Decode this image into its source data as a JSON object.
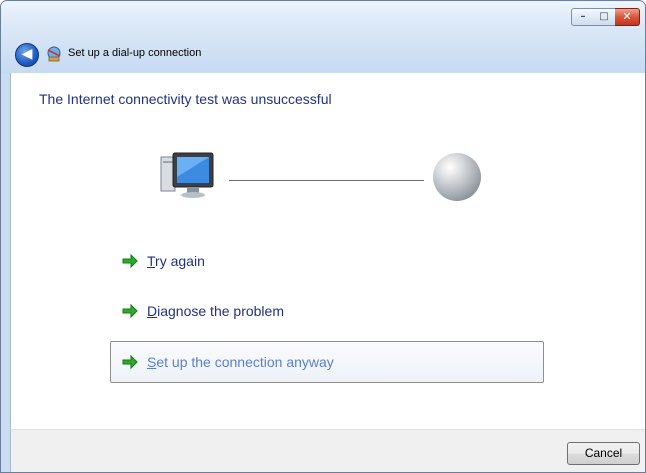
{
  "window": {
    "title": "Set up a dial-up connection",
    "controls": {
      "minimize": "–",
      "maximize": "□",
      "close": "✕"
    }
  },
  "heading": "The Internet connectivity test was unsuccessful",
  "diagram": {
    "left_icon": "computer-icon",
    "right_icon": "globe-icon"
  },
  "tasks": [
    {
      "label": "Try again",
      "accel": "T",
      "rest": "ry again",
      "icon": "green-arrow-icon"
    },
    {
      "label": "Diagnose the problem",
      "accel": "D",
      "rest": "iagnose the problem",
      "icon": "green-arrow-icon"
    },
    {
      "label": "Set up the connection anyway",
      "accel": "S",
      "rest": "et up the connection anyway",
      "icon": "green-arrow-icon",
      "highlighted": true
    }
  ],
  "footer": {
    "cancel_label": "Cancel"
  },
  "colors": {
    "heading": "#1e3287",
    "hover_link": "#5a7fcf",
    "arrow": "#2eaa2e"
  }
}
